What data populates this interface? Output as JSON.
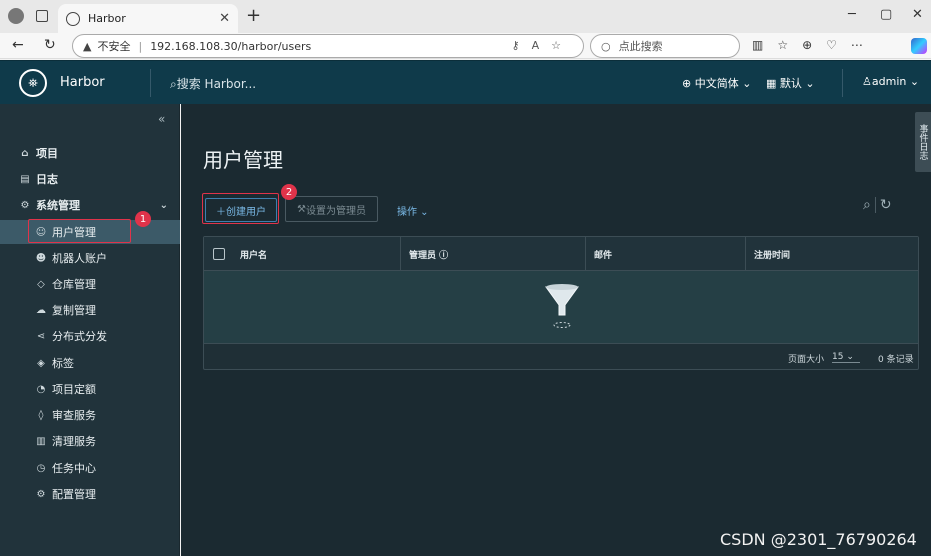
{
  "browser": {
    "tab_title": "Harbor",
    "address_security": "不安全",
    "address_url": "192.168.108.30/harbor/users",
    "search_placeholder": "点此搜索"
  },
  "header": {
    "brand": "Harbor",
    "search_placeholder": "搜索 Harbor...",
    "language": "中文简体",
    "datetime_format": "默认",
    "user": "admin"
  },
  "sidebar": {
    "items": [
      {
        "label": "项目",
        "icon": "projects-icon",
        "level": "top"
      },
      {
        "label": "日志",
        "icon": "logs-icon",
        "level": "top"
      },
      {
        "label": "系统管理",
        "icon": "admin-icon",
        "level": "top"
      },
      {
        "label": "用户管理",
        "icon": "users-icon",
        "level": "sub",
        "active": true
      },
      {
        "label": "机器人账户",
        "icon": "robot-icon",
        "level": "sub"
      },
      {
        "label": "仓库管理",
        "icon": "registry-icon",
        "level": "sub"
      },
      {
        "label": "复制管理",
        "icon": "replication-icon",
        "level": "sub"
      },
      {
        "label": "分布式分发",
        "icon": "distribution-icon",
        "level": "sub"
      },
      {
        "label": "标签",
        "icon": "tag-icon",
        "level": "sub"
      },
      {
        "label": "项目定额",
        "icon": "quota-icon",
        "level": "sub"
      },
      {
        "label": "审查服务",
        "icon": "shield-icon",
        "level": "sub"
      },
      {
        "label": "清理服务",
        "icon": "trash-icon",
        "level": "sub"
      },
      {
        "label": "任务中心",
        "icon": "clock-icon",
        "level": "sub"
      },
      {
        "label": "配置管理",
        "icon": "gear-icon",
        "level": "sub"
      }
    ]
  },
  "main": {
    "title": "用户管理",
    "create_user": "创建用户",
    "set_admin": "设置为管理员",
    "actions": "操作",
    "columns": [
      "用户名",
      "管理员",
      "邮件",
      "注册时间"
    ],
    "page_size_label": "页面大小",
    "page_size": "15",
    "record_count": "0 条记录"
  },
  "annotations": {
    "badge1": "1",
    "badge2": "2"
  },
  "side_tab": "事件日志",
  "watermark": "CSDN @2301_76790264",
  "colors": {
    "header_bg": "#0f3a4a",
    "sidebar_bg": "#21333b",
    "main_bg": "#1b2a31",
    "accent": "#7ab9e6",
    "annotation": "#e0334a"
  }
}
